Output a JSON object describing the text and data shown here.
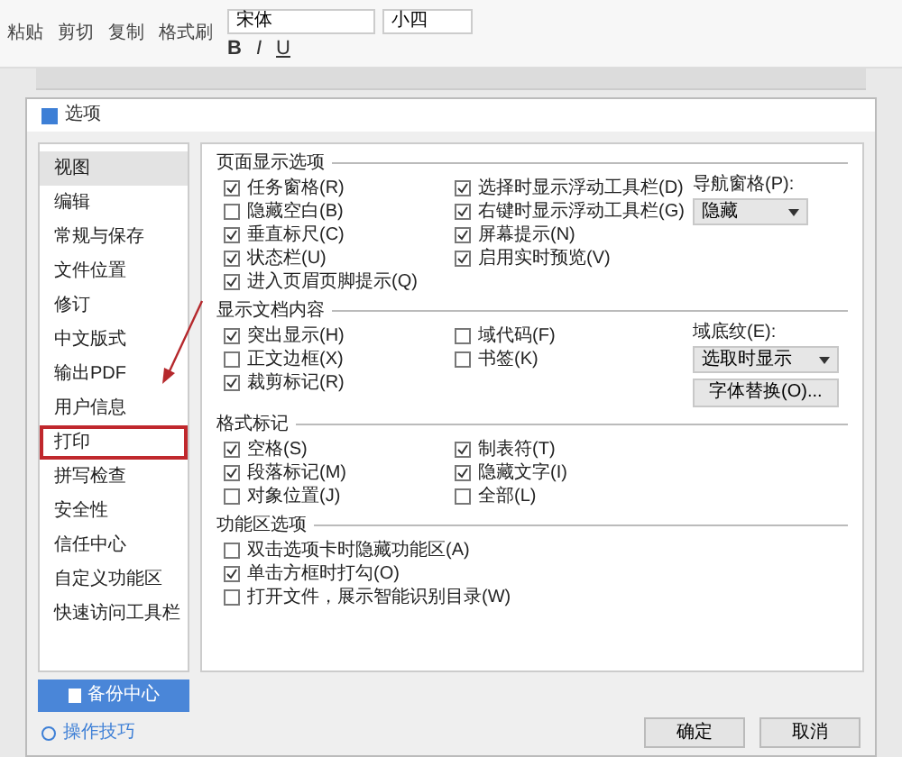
{
  "ribbon": {
    "clipboard": [
      {
        "label": "粘贴"
      },
      {
        "label": "剪切"
      },
      {
        "label": "复制"
      },
      {
        "label": "格式刷"
      }
    ],
    "font": {
      "value": "宋体"
    },
    "size": {
      "value": "小四"
    },
    "format_buttons": [
      "B",
      "I",
      "U"
    ]
  },
  "dialog": {
    "title": "选项",
    "nav": [
      {
        "label": "视图",
        "selected": true,
        "annotated": false
      },
      {
        "label": "编辑",
        "selected": false,
        "annotated": false
      },
      {
        "label": "常规与保存",
        "selected": false,
        "annotated": false
      },
      {
        "label": "文件位置",
        "selected": false,
        "annotated": false
      },
      {
        "label": "修订",
        "selected": false,
        "annotated": false
      },
      {
        "label": "中文版式",
        "selected": false,
        "annotated": false
      },
      {
        "label": "输出PDF",
        "selected": false,
        "annotated": false
      },
      {
        "label": "用户信息",
        "selected": false,
        "annotated": false
      },
      {
        "label": "打印",
        "selected": false,
        "annotated": true
      },
      {
        "label": "拼写检查",
        "selected": false,
        "annotated": false
      },
      {
        "label": "安全性",
        "selected": false,
        "annotated": false
      },
      {
        "label": "信任中心",
        "selected": false,
        "annotated": false
      },
      {
        "label": "自定义功能区",
        "selected": false,
        "annotated": false
      },
      {
        "label": "快速访问工具栏",
        "selected": false,
        "annotated": false
      }
    ],
    "sections": [
      {
        "title": "页面显示选项",
        "columns": [
          [
            {
              "label": "任务窗格(R)",
              "checked": true
            },
            {
              "label": "隐藏空白(B)",
              "checked": false
            },
            {
              "label": "垂直标尺(C)",
              "checked": true
            },
            {
              "label": "状态栏(U)",
              "checked": true
            },
            {
              "label": "进入页眉页脚提示(Q)",
              "checked": true
            }
          ],
          [
            {
              "label": "选择时显示浮动工具栏(D)",
              "checked": true
            },
            {
              "label": "右键时显示浮动工具栏(G)",
              "checked": true
            },
            {
              "label": "屏幕提示(N)",
              "checked": true
            },
            {
              "label": "启用实时预览(V)",
              "checked": true
            }
          ]
        ],
        "side": [
          {
            "kind": "dropdown",
            "label": "导航窗格(P):",
            "value": "隐藏"
          }
        ]
      },
      {
        "title": "显示文档内容",
        "columns": [
          [
            {
              "label": "突出显示(H)",
              "checked": true
            },
            {
              "label": "正文边框(X)",
              "checked": false
            },
            {
              "label": "裁剪标记(R)",
              "checked": true
            }
          ],
          [
            {
              "label": "域代码(F)",
              "checked": false
            },
            {
              "label": "书签(K)",
              "checked": false
            }
          ]
        ],
        "side": [
          {
            "kind": "dropdown",
            "label": "域底纹(E):",
            "value": "选取时显示"
          },
          {
            "kind": "button",
            "label": "字体替换(O)..."
          }
        ]
      },
      {
        "title": "格式标记",
        "columns": [
          [
            {
              "label": "空格(S)",
              "checked": true
            },
            {
              "label": "段落标记(M)",
              "checked": true
            },
            {
              "label": "对象位置(J)",
              "checked": false
            }
          ],
          [
            {
              "label": "制表符(T)",
              "checked": true
            },
            {
              "label": "隐藏文字(I)",
              "checked": true
            },
            {
              "label": "全部(L)",
              "checked": false
            }
          ]
        ]
      },
      {
        "title": "功能区选项",
        "columns": [
          [
            {
              "label": "双击选项卡时隐藏功能区(A)",
              "checked": false
            },
            {
              "label": "单击方框时打勾(O)",
              "checked": true
            },
            {
              "label": "打开文件，展示智能识别目录(W)",
              "checked": false
            }
          ]
        ]
      }
    ],
    "backup_button": "备份中心",
    "tips_link": "操作技巧",
    "buttons": [
      "确定",
      "取消"
    ]
  }
}
